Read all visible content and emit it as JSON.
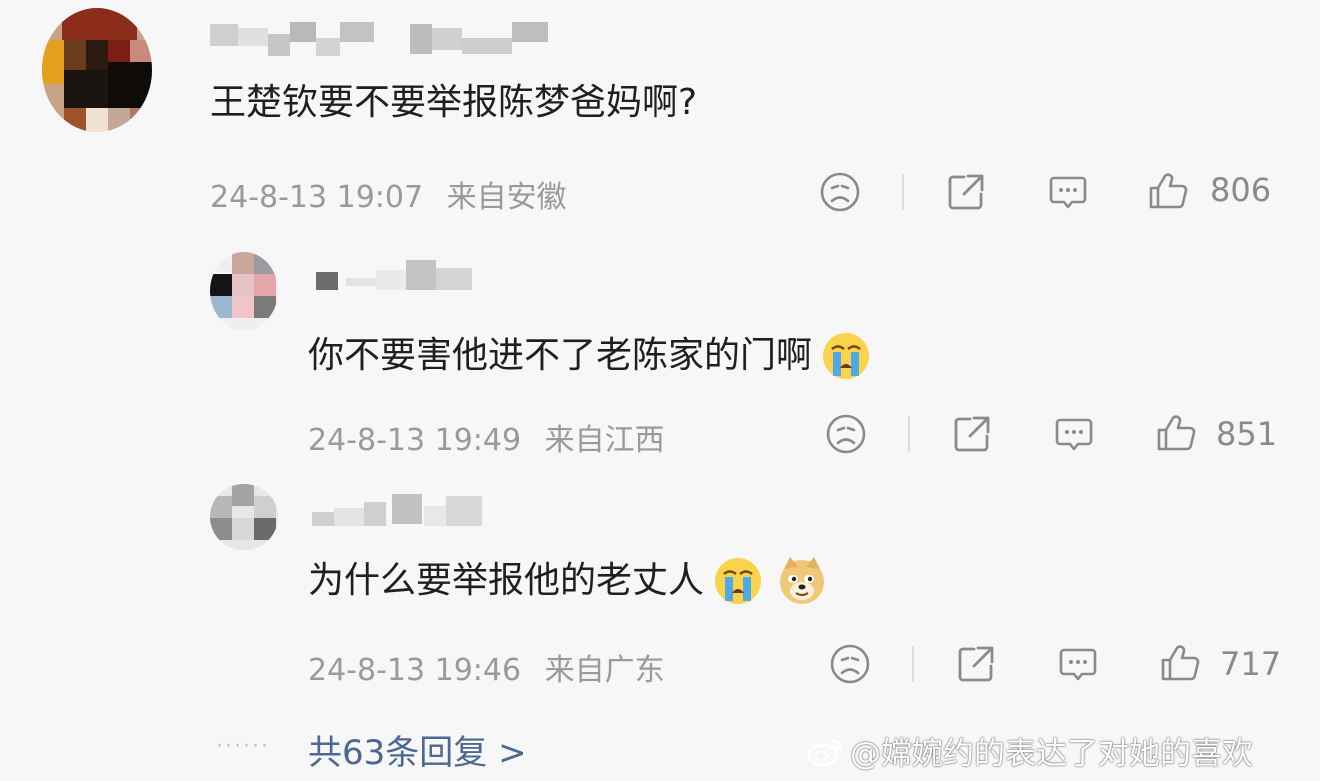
{
  "comments": [
    {
      "text": "王楚钦要不要举报陈梦爸妈啊?",
      "timestamp": "24-8-13 19:07",
      "location": "来自安徽",
      "likes": "806",
      "emojis": []
    },
    {
      "text": "你不要害他进不了老陈家的门啊",
      "timestamp": "24-8-13 19:49",
      "location": "来自江西",
      "likes": "851",
      "emojis": [
        "crying-emoji"
      ]
    },
    {
      "text": "为什么要举报他的老丈人",
      "timestamp": "24-8-13 19:46",
      "location": "来自广东",
      "likes": "717",
      "emojis": [
        "crying-emoji",
        "doge-emoji"
      ]
    }
  ],
  "footer": {
    "dots": "······",
    "reply_link": "共63条回复 >"
  },
  "watermark": {
    "text": "@嫦婉约的表达了对她的喜欢"
  },
  "icons": [
    "sad-face-icon",
    "share-icon",
    "comment-icon",
    "thumbs-up-icon",
    "weibo-logo-icon"
  ],
  "colors": {
    "background": "#f7f7f7",
    "meta_gray": "#9a9a9a",
    "link_blue": "#4a6890"
  }
}
